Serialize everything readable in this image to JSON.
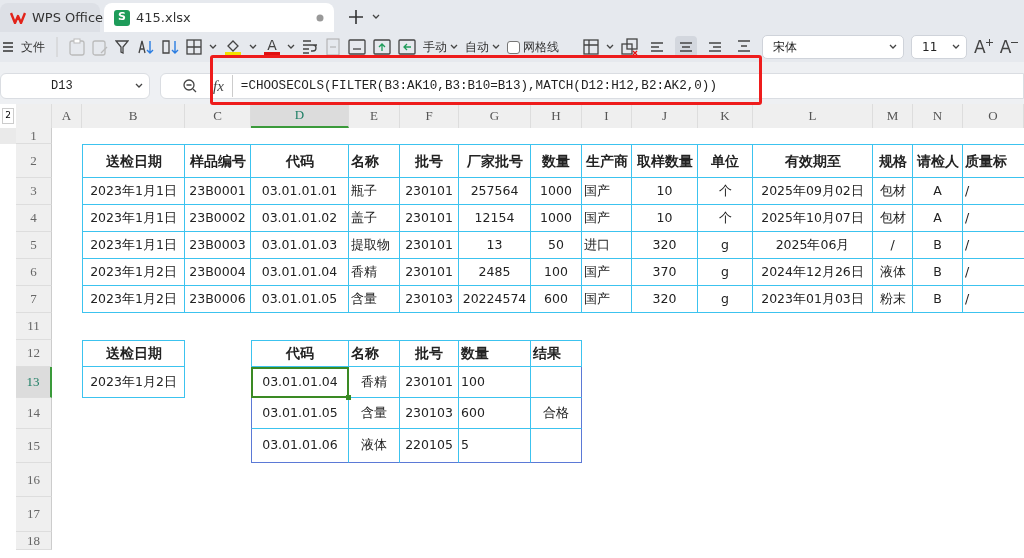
{
  "tabs": [
    {
      "label": "WPS Office",
      "kind": "home",
      "selected": false
    },
    {
      "label": "415.xlsx",
      "kind": "sheet",
      "badge": "S",
      "selected": true,
      "unsaved": true
    }
  ],
  "toolbar": {
    "menu": "文件",
    "row_height": "手动",
    "column_width": "自动",
    "gridlines": {
      "label": "网格线",
      "checked": false
    },
    "alignment": [
      {
        "kind": "left",
        "selected": false
      },
      {
        "kind": "center",
        "selected": true
      },
      {
        "kind": "right",
        "selected": false
      },
      {
        "kind": "top",
        "selected": false
      }
    ],
    "font_color_glyph": "A",
    "font_name": "宋体",
    "font_size": "11",
    "grow_glyph": "A",
    "shrink_glyph": "A"
  },
  "name_box": "D13",
  "fx_label": "fx",
  "formula": "=CHOOSECOLS(FILTER(B3:AK10,B3:B10=B13),MATCH(D12:H12,B2:AK2,0))",
  "formula_highlighted": true,
  "outline_level": "2",
  "columns": [
    {
      "label": "A",
      "selected": false
    },
    {
      "label": "B",
      "selected": false
    },
    {
      "label": "C",
      "selected": false
    },
    {
      "label": "D",
      "selected": true
    },
    {
      "label": "E",
      "selected": false
    },
    {
      "label": "F",
      "selected": false
    },
    {
      "label": "G",
      "selected": false
    },
    {
      "label": "H",
      "selected": false
    },
    {
      "label": "I",
      "selected": false
    },
    {
      "label": "J",
      "selected": false
    },
    {
      "label": "K",
      "selected": false
    },
    {
      "label": "L",
      "selected": false
    },
    {
      "label": "M",
      "selected": false
    },
    {
      "label": "N",
      "selected": false
    },
    {
      "label": "O",
      "selected": false
    }
  ],
  "rows": [
    {
      "label": "1",
      "selected": false
    },
    {
      "label": "2",
      "selected": false
    },
    {
      "label": "3",
      "selected": false
    },
    {
      "label": "4",
      "selected": false
    },
    {
      "label": "5",
      "selected": false
    },
    {
      "label": "6",
      "selected": false
    },
    {
      "label": "7",
      "selected": false
    },
    {
      "label": "11",
      "selected": false
    },
    {
      "label": "12",
      "selected": false
    },
    {
      "label": "13",
      "selected": true
    },
    {
      "label": "14",
      "selected": false
    },
    {
      "label": "15",
      "selected": false
    },
    {
      "label": "16",
      "selected": false
    },
    {
      "label": "17",
      "selected": false
    },
    {
      "label": "18",
      "selected": false
    }
  ],
  "source_table": {
    "header": [
      "送检日期",
      "样品编号",
      "代码",
      "名称",
      "批号",
      "厂家批号",
      "数量",
      "生产商",
      "取样数量",
      "单位",
      "有效期至",
      "规格",
      "请检人",
      "质量标"
    ],
    "rows": [
      [
        "2023年1月1日",
        "23B0001",
        "03.01.01.01",
        "瓶子",
        "230101",
        "257564",
        "1000",
        "国产",
        "10",
        "个",
        "2025年09月02日",
        "包材",
        "A",
        "/"
      ],
      [
        "2023年1月1日",
        "23B0002",
        "03.01.01.02",
        "盖子",
        "230101",
        "12154",
        "1000",
        "国产",
        "10",
        "个",
        "2025年10月07日",
        "包材",
        "A",
        "/"
      ],
      [
        "2023年1月1日",
        "23B0003",
        "03.01.01.03",
        "提取物",
        "230101",
        "13",
        "50",
        "进口",
        "320",
        "g",
        "2025年06月",
        "/",
        "B",
        "/"
      ],
      [
        "2023年1月2日",
        "23B0004",
        "03.01.01.04",
        "香精",
        "230101",
        "2485",
        "100",
        "国产",
        "370",
        "g",
        "2024年12月26日",
        "液体",
        "B",
        "/"
      ],
      [
        "2023年1月2日",
        "23B0006",
        "03.01.01.05",
        "含量",
        "230103",
        "20224574",
        "600",
        "国产",
        "320",
        "g",
        "2023年01月03日",
        "粉末",
        "B",
        "/"
      ]
    ]
  },
  "lookup": {
    "header": "送检日期",
    "value": "2023年1月2日"
  },
  "result_table": {
    "header": [
      "代码",
      "名称",
      "批号",
      "数量",
      "结果"
    ],
    "rows": [
      {
        "code": "03.01.01.04",
        "name": "香精",
        "batch": "230101",
        "quantity": "100",
        "code_selected": true
      },
      {
        "code": "03.01.01.05",
        "name": "含量",
        "batch": "230103",
        "quantity": "600",
        "result": "合格",
        "code_selected": false
      },
      {
        "code": "03.01.01.06",
        "name": "液体",
        "batch": "220105",
        "quantity": "5",
        "code_selected": false
      }
    ]
  }
}
